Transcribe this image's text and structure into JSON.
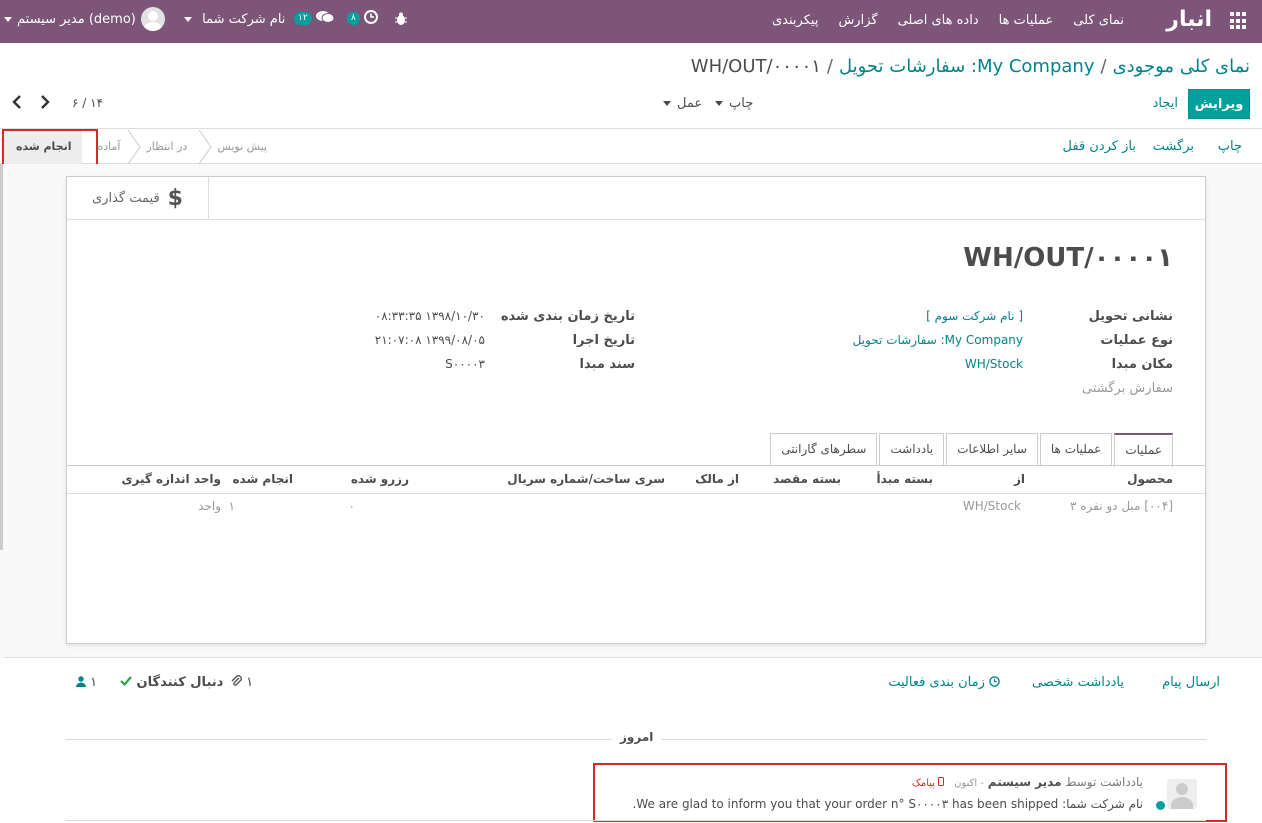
{
  "navbar": {
    "brand": "انبار",
    "menu": [
      "نمای کلی",
      "عملیات ها",
      "داده های اصلی",
      "گزارش",
      "پیکربندی"
    ],
    "user": "مدیر سیستم (demo)",
    "company": "نام شرکت شما",
    "messages_count": "۱۲",
    "activities_count": "۸",
    "accent": "#7c5578"
  },
  "breadcrumb": {
    "item1": "نمای کلی موجودی",
    "item2": "My Company: سفارشات تحویل",
    "current": "WH/OUT/۰۰۰۰۱",
    "sep": "/"
  },
  "controls": {
    "edit": "ویرایش",
    "create": "ایجاد",
    "print": "چاپ",
    "action": "عمل",
    "pager": "۶ / ۱۴"
  },
  "statusbar": {
    "buttons": [
      "چاپ",
      "برگشت",
      "باز کردن قفل"
    ],
    "stages": [
      "انجام شده",
      "آماده",
      "در انتظار",
      "پیش نویس"
    ],
    "current_stage": "انجام شده"
  },
  "form": {
    "stat_button": "قیمت گذاری",
    "title": "WH/OUT/۰۰۰۰۱",
    "right_fields": [
      {
        "label": "نشانی تحویل",
        "value": "[ نام شرکت سوم ]"
      },
      {
        "label": "نوع عملیات",
        "value": "My Company: سفارشات تحویل"
      },
      {
        "label": "مکان مبدا",
        "value": "WH/Stock"
      }
    ],
    "return_label": "سفارش برگشتی",
    "left_fields": [
      {
        "label": "تاریخ زمان بندی شده",
        "value": "۱۳۹۸/۱۰/۳۰ ۰۸:۳۳:۳۵"
      },
      {
        "label": "تاریخ اجرا",
        "value": "۱۳۹۹/۰۸/۰۵ ۲۱:۰۷:۰۸"
      },
      {
        "label": "سند مبدا",
        "value": "S۰۰۰۰۳"
      }
    ],
    "tabs": [
      "عملیات",
      "عملیات ها",
      "سایر اطلاعات",
      "یادداشت",
      "سطرهای گارانتی"
    ],
    "columns": [
      "محصول",
      "از",
      "بسته مبدأ",
      "بسته مقصد",
      "از مالک",
      "سری ساخت/شماره سریال",
      "رزرو شده",
      "انجام شده",
      "واحد اندازه گیری"
    ],
    "row": {
      "product": "[۰۰۴] مبل دو نفره ۳",
      "from": "WH/Stock",
      "reserved": "۰",
      "done": "۱",
      "uom": "واحد"
    }
  },
  "chatter": {
    "send_message": "ارسال پیام",
    "log_note": "یادداشت شخصی",
    "schedule": "زمان بندی فعالیت",
    "attachments": "۱",
    "followers_label": "دنبال کنندگان",
    "followers_count": "۱",
    "today": "امروز",
    "msg_prefix": "یادداشت توسط",
    "msg_author": "مدیر سیستم",
    "msg_time": "- اکنون",
    "msg_sms": "پیامک",
    "msg_body": "نام شرکت شما: We are glad to inform you that your order n° S۰۰۰۰۳ has been shipped."
  }
}
